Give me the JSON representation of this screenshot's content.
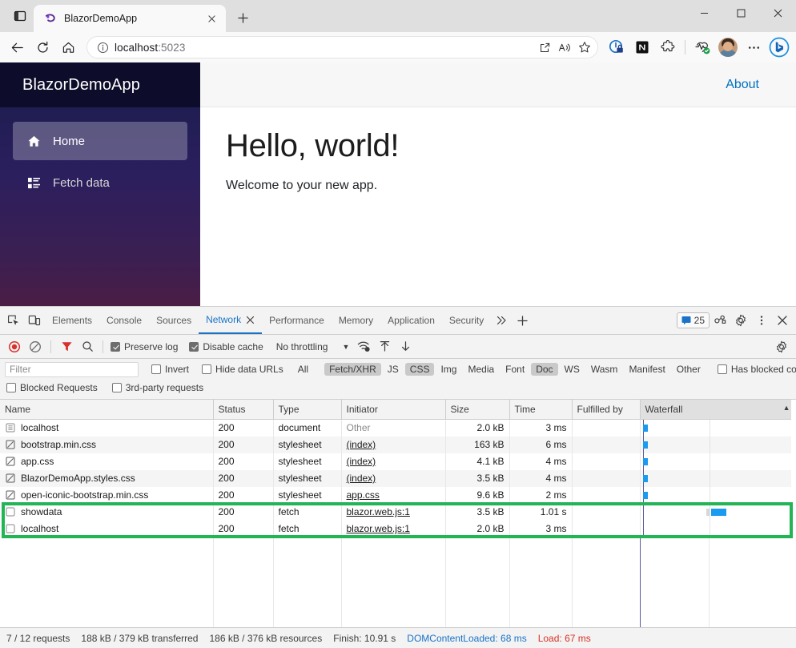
{
  "browser": {
    "tab": {
      "title": "BlazorDemoApp"
    },
    "url": {
      "host": "localhost",
      "port": ":5023"
    },
    "window_controls": {
      "minimize": "—",
      "maximize": "☐",
      "close": "✕"
    },
    "toolbar_icons": {
      "back": "back-arrow-icon",
      "reload": "reload-icon",
      "home": "home-icon",
      "info": "site-info-icon",
      "split": "split-screen-icon",
      "read_aloud": "read-aloud-icon",
      "favorite": "favorite-star-icon",
      "more": "more-options-icon",
      "copilot": "bing-copilot-icon"
    }
  },
  "app": {
    "brand": "BlazorDemoApp",
    "nav": [
      {
        "label": "Home",
        "icon": "home-icon",
        "active": true
      },
      {
        "label": "Fetch data",
        "icon": "list-rich-icon",
        "active": false
      }
    ],
    "about_link": "About",
    "heading": "Hello, world!",
    "subtext": "Welcome to your new app."
  },
  "devtools": {
    "tabs": [
      {
        "label": "Elements",
        "active": false
      },
      {
        "label": "Console",
        "active": false
      },
      {
        "label": "Sources",
        "active": false
      },
      {
        "label": "Network",
        "active": true,
        "closeable": true
      },
      {
        "label": "Performance",
        "active": false
      },
      {
        "label": "Memory",
        "active": false
      },
      {
        "label": "Application",
        "active": false
      },
      {
        "label": "Security",
        "active": false
      }
    ],
    "more_tabs": "»",
    "add_tab": "+",
    "issues_count": "25",
    "toolbar": {
      "record_label": "record-stop-icon",
      "clear_label": "clear-icon",
      "filter_label": "filter-icon",
      "search_label": "search-icon",
      "preserve_log": "Preserve log",
      "preserve_log_checked": true,
      "disable_cache": "Disable cache",
      "disable_cache_checked": true,
      "throttling": "No throttling",
      "throttling_caret": "▼"
    },
    "filter": {
      "placeholder": "Filter",
      "value": "",
      "invert": "Invert",
      "invert_checked": false,
      "hide_data_urls": "Hide data URLs",
      "hide_data_urls_checked": false,
      "types": [
        {
          "label": "All",
          "active": false
        },
        {
          "label": "Fetch/XHR",
          "active": true
        },
        {
          "label": "JS",
          "active": false
        },
        {
          "label": "CSS",
          "active": true
        },
        {
          "label": "Img",
          "active": false
        },
        {
          "label": "Media",
          "active": false
        },
        {
          "label": "Font",
          "active": false
        },
        {
          "label": "Doc",
          "active": true
        },
        {
          "label": "WS",
          "active": false
        },
        {
          "label": "Wasm",
          "active": false
        },
        {
          "label": "Manifest",
          "active": false
        },
        {
          "label": "Other",
          "active": false
        }
      ],
      "has_blocked_cookies": "Has blocked cookies",
      "has_blocked_cookies_checked": false,
      "blocked_requests": "Blocked Requests",
      "blocked_requests_checked": false,
      "third_party": "3rd-party requests",
      "third_party_checked": false
    },
    "table": {
      "columns": [
        "Name",
        "Status",
        "Type",
        "Initiator",
        "Size",
        "Time",
        "Fulfilled by",
        "Waterfall"
      ],
      "sort_indicator": "▲",
      "rows": [
        {
          "name": "localhost",
          "icon": "document-icon",
          "status": "200",
          "type": "document",
          "initiator": "Other",
          "initiator_link": false,
          "size": "2.0 kB",
          "time": "3 ms",
          "fulfilled_by": "",
          "wf_start": 1.5,
          "wf_width": 2.5,
          "highlighted": false
        },
        {
          "name": "bootstrap.min.css",
          "icon": "stylesheet-icon",
          "status": "200",
          "type": "stylesheet",
          "initiator": "(index)",
          "initiator_link": true,
          "size": "163 kB",
          "time": "6 ms",
          "fulfilled_by": "",
          "wf_start": 1.5,
          "wf_width": 2.5,
          "highlighted": false
        },
        {
          "name": "app.css",
          "icon": "stylesheet-icon",
          "status": "200",
          "type": "stylesheet",
          "initiator": "(index)",
          "initiator_link": true,
          "size": "4.1 kB",
          "time": "4 ms",
          "fulfilled_by": "",
          "wf_start": 1.5,
          "wf_width": 2.5,
          "highlighted": false
        },
        {
          "name": "BlazorDemoApp.styles.css",
          "icon": "stylesheet-icon",
          "status": "200",
          "type": "stylesheet",
          "initiator": "(index)",
          "initiator_link": true,
          "size": "3.5 kB",
          "time": "4 ms",
          "fulfilled_by": "",
          "wf_start": 1.5,
          "wf_width": 2.5,
          "highlighted": false
        },
        {
          "name": "open-iconic-bootstrap.min.css",
          "icon": "stylesheet-icon",
          "status": "200",
          "type": "stylesheet",
          "initiator": "app.css",
          "initiator_link": true,
          "size": "9.6 kB",
          "time": "2 ms",
          "fulfilled_by": "",
          "wf_start": 1.5,
          "wf_width": 2.5,
          "highlighted": false
        },
        {
          "name": "showdata",
          "icon": "fetch-icon",
          "status": "200",
          "type": "fetch",
          "initiator": "blazor.web.js:1",
          "initiator_link": true,
          "size": "3.5 kB",
          "time": "1.01 s",
          "fulfilled_by": "",
          "wf_start": 47.0,
          "wf_width": 9.0,
          "highlighted": true
        },
        {
          "name": "localhost",
          "icon": "fetch-icon",
          "status": "200",
          "type": "fetch",
          "initiator": "blazor.web.js:1",
          "initiator_link": true,
          "size": "2.0 kB",
          "time": "3 ms",
          "fulfilled_by": "",
          "wf_start": 1.0,
          "wf_width": 1.5,
          "highlighted": true
        }
      ]
    },
    "status_bar": {
      "requests": "7 / 12 requests",
      "transferred": "188 kB / 379 kB transferred",
      "resources": "186 kB / 376 kB resources",
      "finish": "Finish: 10.91 s",
      "dom_content_loaded": "DOMContentLoaded: 68 ms",
      "load": "Load: 67 ms"
    }
  },
  "colors": {
    "accent_blue": "#1a73c7",
    "highlight_green": "#22b455",
    "waterfall_blue": "#1a9bf0",
    "load_red": "#d93025",
    "brand_dark": "#0d0d2b"
  }
}
